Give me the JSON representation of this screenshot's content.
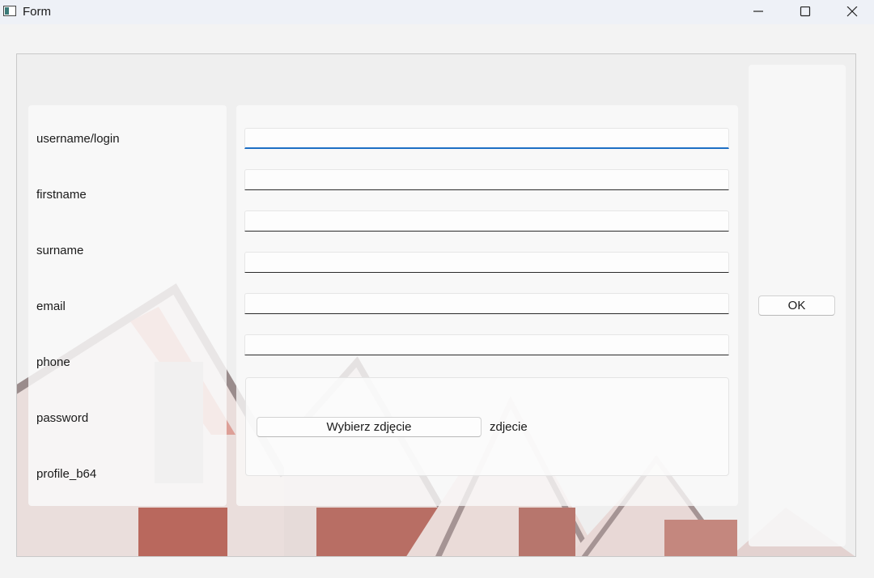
{
  "window": {
    "title": "Form",
    "controls": [
      "minimize-icon",
      "maximize-icon",
      "close-icon"
    ]
  },
  "form": {
    "labels": [
      "username/login",
      "firstname",
      "surname",
      "email",
      "phone",
      "password",
      "profile_b64"
    ],
    "inputs": [
      {
        "value": "",
        "placeholder": ""
      },
      {
        "value": "",
        "placeholder": ""
      },
      {
        "value": "",
        "placeholder": ""
      },
      {
        "value": "",
        "placeholder": ""
      },
      {
        "value": "",
        "placeholder": ""
      },
      {
        "value": "",
        "placeholder": ""
      }
    ],
    "photo": {
      "button_label": "Wybierz zdjęcie",
      "label": "zdjecie"
    }
  },
  "actions": {
    "ok_label": "OK"
  },
  "colors": {
    "accent": "#1d6fc4",
    "window_bg": "#f3f3f3",
    "titlebar_bg": "#eef1f7"
  }
}
